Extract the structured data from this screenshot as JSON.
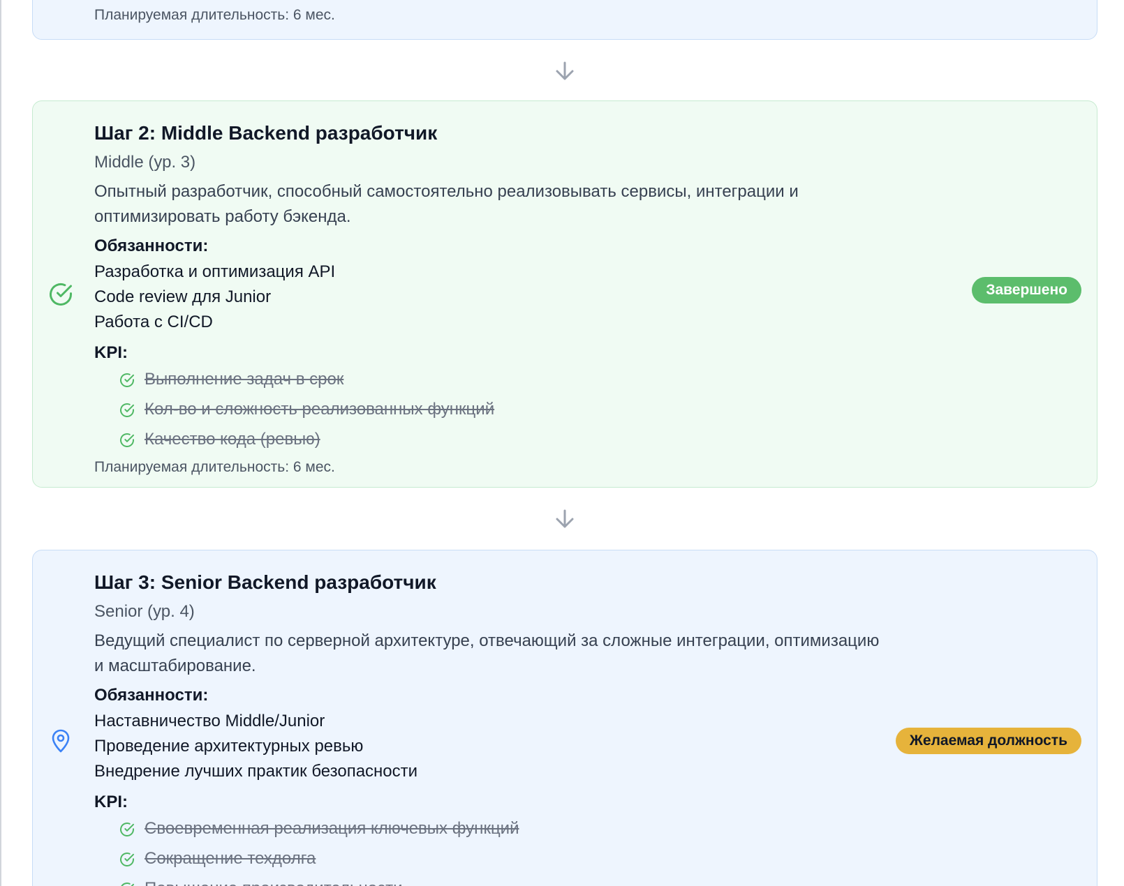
{
  "colors": {
    "done_card_bg": "#f0fbf3",
    "current_card_bg": "#eef5fe",
    "done_badge": "#5cbd6c",
    "target_badge": "#e6b33b",
    "check_icon": "#4fb864",
    "location_icon": "#3b82f6",
    "arrow": "#9ca3af"
  },
  "step1": {
    "duration": "Планируемая длительность: 6 мес."
  },
  "step2": {
    "title": "Шаг 2: Middle Backend разработчик",
    "level": "Middle (ур. 3)",
    "description": "Опытный разработчик, способный самостоятельно реализовывать сервисы, интеграции и оптимизировать работу бэкенда.",
    "responsibilities_label": "Обязанности:",
    "responsibilities": [
      "Разработка и оптимизация API",
      "Code review для Junior",
      "Работа с CI/CD"
    ],
    "kpi_label": "KPI:",
    "kpis": [
      "Выполнение задач в срок",
      "Кол-во и сложность реализованных функций",
      "Качество кода (ревью)"
    ],
    "duration": "Планируемая длительность: 6 мес.",
    "status_icon": "check-circle-icon",
    "badge": "Завершено"
  },
  "step3": {
    "title": "Шаг 3: Senior Backend разработчик",
    "level": "Senior (ур. 4)",
    "description": "Ведущий специалист по серверной архитектуре, отвечающий за сложные интеграции, оптимизацию и масштабирование.",
    "responsibilities_label": "Обязанности:",
    "responsibilities": [
      "Наставничество Middle/Junior",
      "Проведение архитектурных ревью",
      "Внедрение лучших практик безопасности"
    ],
    "kpi_label": "KPI:",
    "kpis": [
      "Своевременная реализация ключевых функций",
      "Сокращение техдолга",
      "Повышение производительности"
    ],
    "status_icon": "location-pin-icon",
    "badge": "Желаемая должность"
  }
}
